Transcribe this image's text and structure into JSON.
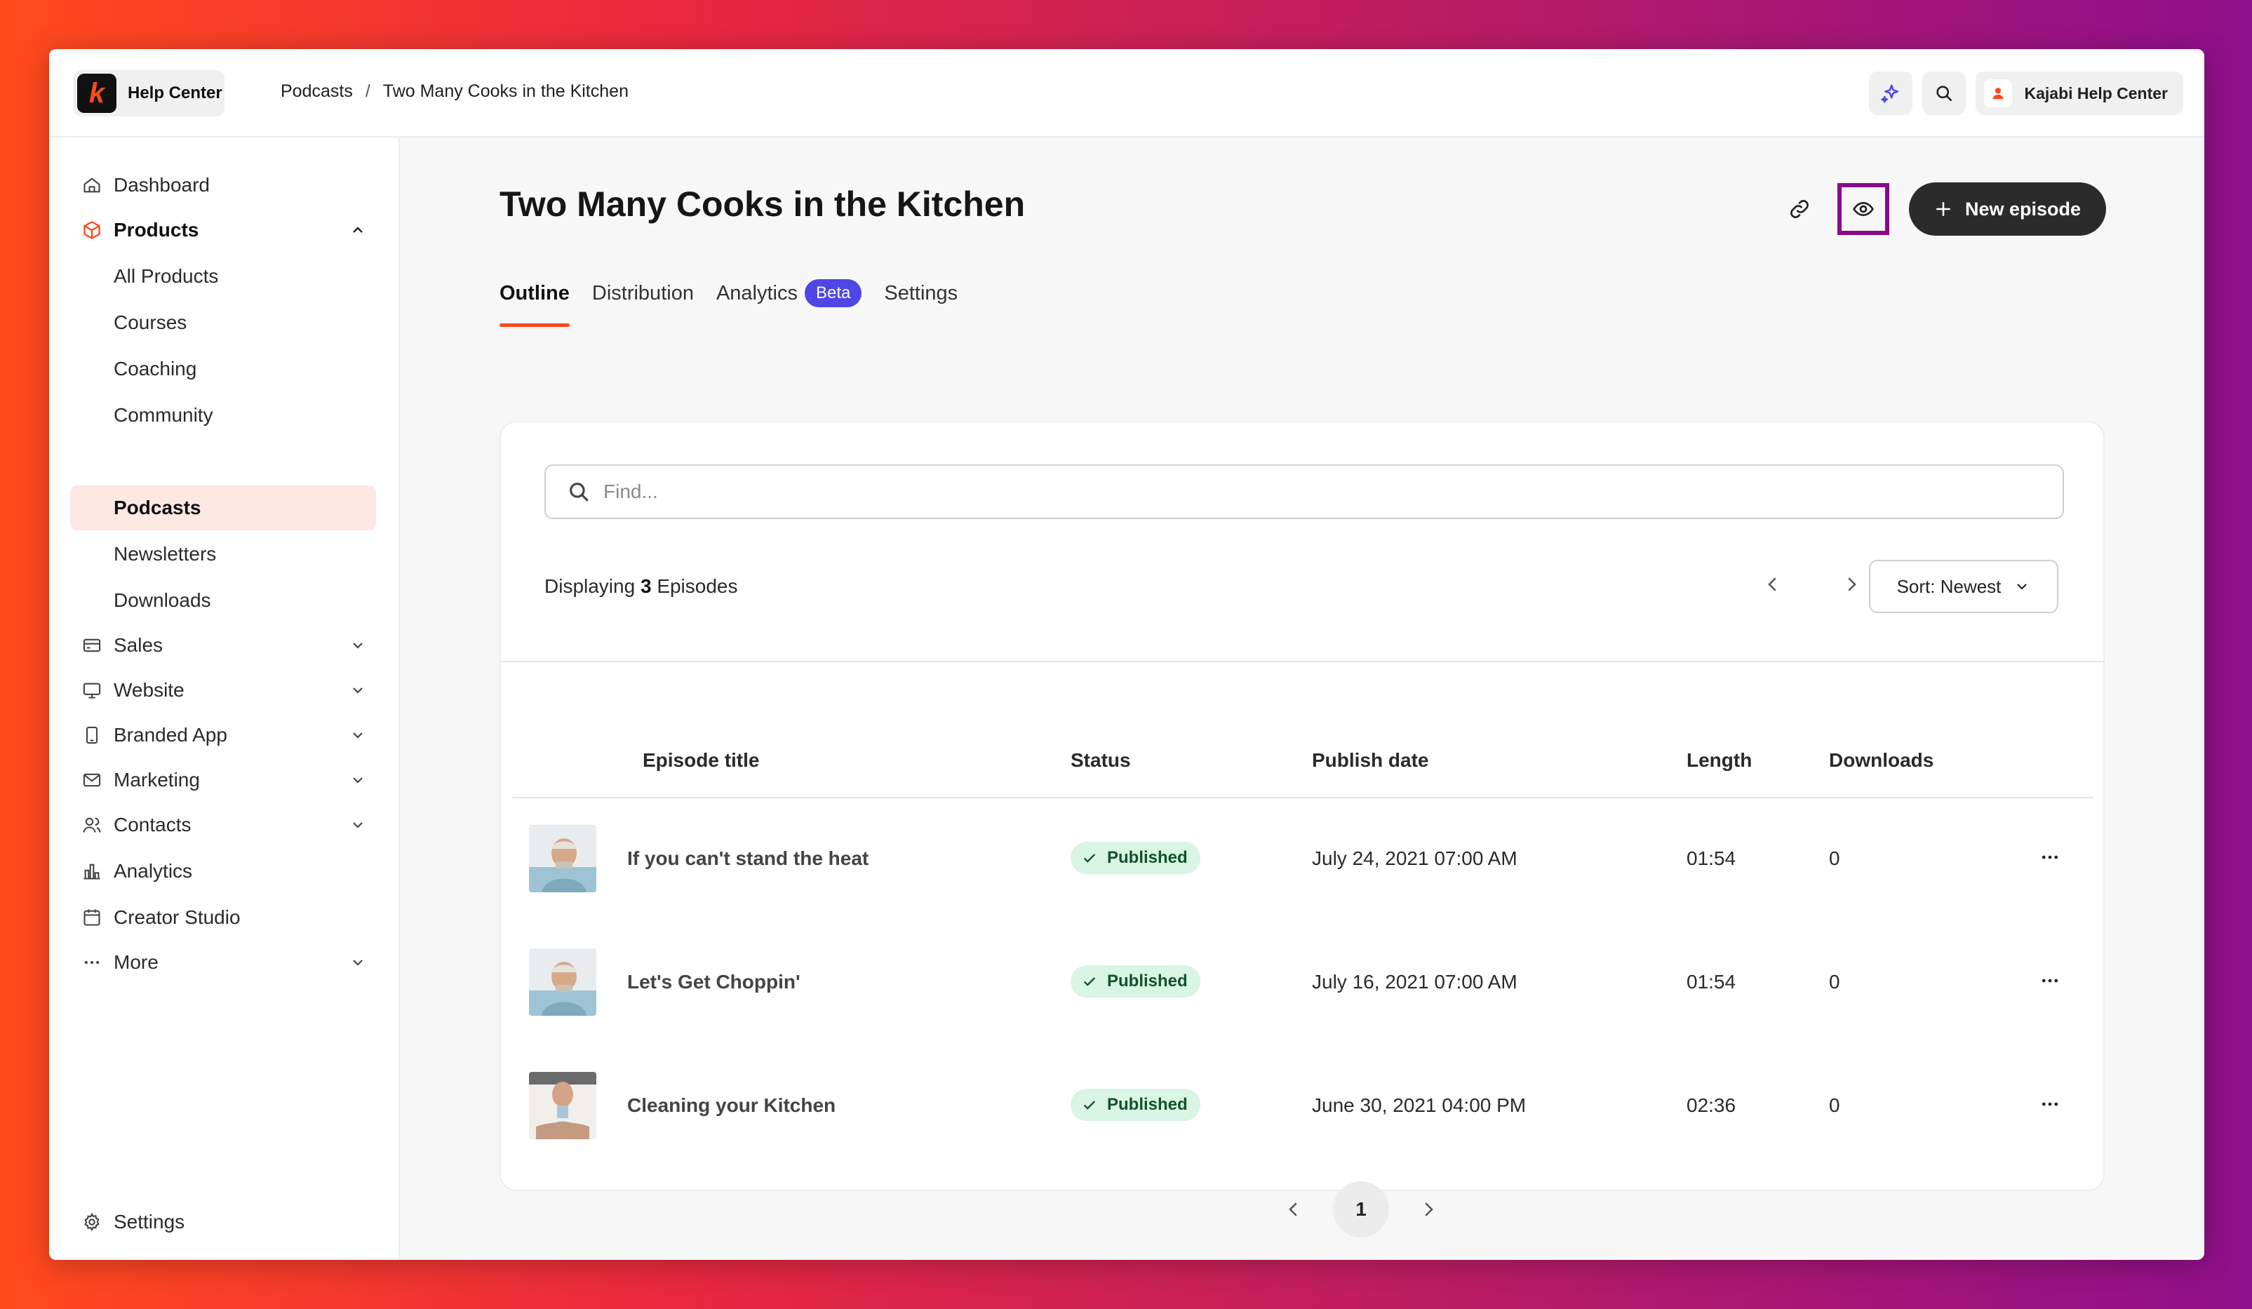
{
  "brand": {
    "name": "Help Center",
    "logo_letter": "k"
  },
  "breadcrumb": {
    "parent": "Podcasts",
    "separator": "/",
    "current": "Two Many Cooks in the Kitchen"
  },
  "topbar": {
    "account_label": "Kajabi Help Center"
  },
  "sidebar": {
    "items": [
      {
        "label": "Dashboard",
        "icon": "home-icon"
      },
      {
        "label": "Products",
        "icon": "box-icon"
      },
      {
        "label": "All Products"
      },
      {
        "label": "Courses"
      },
      {
        "label": "Coaching"
      },
      {
        "label": "Community"
      },
      {
        "label": "Podcasts"
      },
      {
        "label": "Newsletters"
      },
      {
        "label": "Downloads"
      },
      {
        "label": "Sales",
        "icon": "credit-card-icon"
      },
      {
        "label": "Website",
        "icon": "monitor-icon"
      },
      {
        "label": "Branded App",
        "icon": "phone-icon"
      },
      {
        "label": "Marketing",
        "icon": "mail-icon"
      },
      {
        "label": "Contacts",
        "icon": "users-icon"
      },
      {
        "label": "Analytics",
        "icon": "bar-chart-icon"
      },
      {
        "label": "Creator Studio",
        "icon": "calendar-icon"
      },
      {
        "label": "More",
        "icon": "dots-icon"
      }
    ],
    "settings_label": "Settings"
  },
  "page": {
    "title": "Two Many Cooks in the Kitchen",
    "new_episode_label": "New episode",
    "tabs": [
      {
        "label": "Outline"
      },
      {
        "label": "Distribution"
      },
      {
        "label": "Analytics",
        "badge": "Beta"
      },
      {
        "label": "Settings"
      }
    ]
  },
  "list": {
    "search_placeholder": "Find...",
    "displaying_prefix": "Displaying",
    "count": "3",
    "displaying_suffix": "Episodes",
    "sort_label": "Sort: Newest",
    "columns": {
      "title": "Episode title",
      "status": "Status",
      "publish_date": "Publish date",
      "length": "Length",
      "downloads": "Downloads"
    },
    "episodes": [
      {
        "title": "If you can't stand the heat",
        "status": "Published",
        "publish_date": "July 24, 2021 07:00 AM",
        "length": "01:54",
        "downloads": "0"
      },
      {
        "title": "Let's Get Choppin'",
        "status": "Published",
        "publish_date": "July 16, 2021 07:00 AM",
        "length": "01:54",
        "downloads": "0"
      },
      {
        "title": "Cleaning your Kitchen",
        "status": "Published",
        "publish_date": "June 30, 2021 04:00 PM",
        "length": "02:36",
        "downloads": "0"
      }
    ],
    "current_page": "1"
  },
  "colors": {
    "accent": "#ff4a1c",
    "beta": "#4f46e5",
    "highlight": "#8b0a8b",
    "published_bg": "#d9f5e4"
  }
}
